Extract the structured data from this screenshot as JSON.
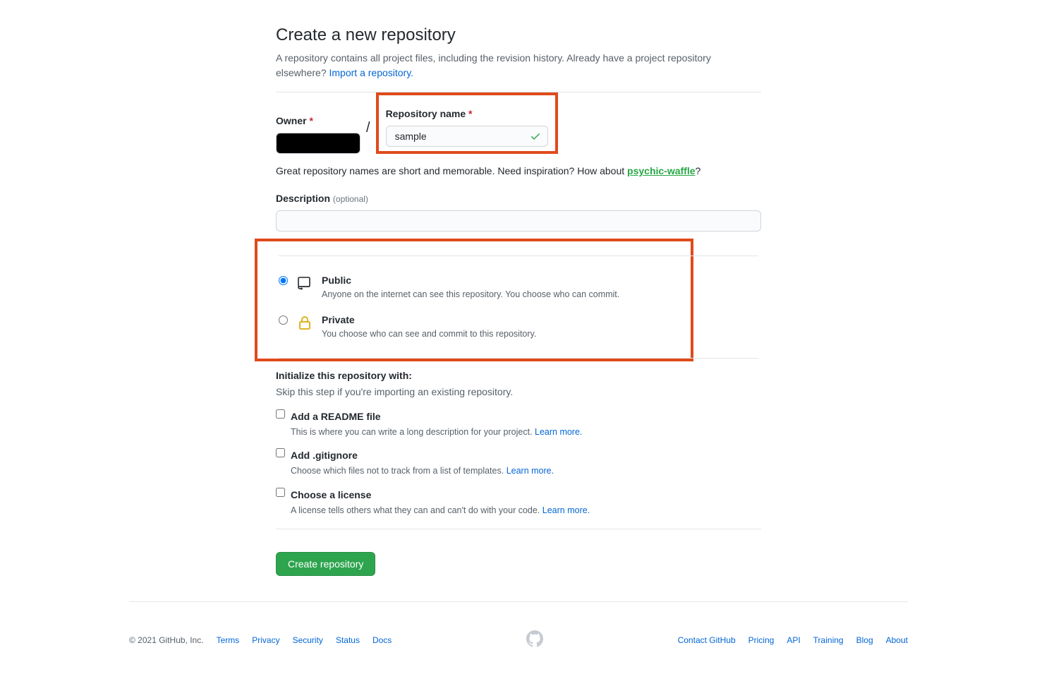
{
  "header": {
    "title": "Create a new repository",
    "subtitle_pre": "A repository contains all project files, including the revision history. Already have a project repository elsewhere? ",
    "import_link": "Import a repository."
  },
  "form": {
    "owner_label": "Owner",
    "repo_label": "Repository name",
    "repo_value": "sample",
    "hint_pre": "Great repository names are short and memorable. Need inspiration? How about ",
    "suggestion": "psychic-waffle",
    "hint_post": "?",
    "description_label": "Description",
    "optional_label": "(optional)",
    "description_value": ""
  },
  "visibility": {
    "public": {
      "title": "Public",
      "desc": "Anyone on the internet can see this repository. You choose who can commit."
    },
    "private": {
      "title": "Private",
      "desc": "You choose who can see and commit to this repository."
    }
  },
  "init": {
    "heading": "Initialize this repository with:",
    "sub": "Skip this step if you're importing an existing repository.",
    "readme": {
      "title": "Add a README file",
      "desc": "This is where you can write a long description for your project. ",
      "learn": "Learn more."
    },
    "gitignore": {
      "title": "Add .gitignore",
      "desc": "Choose which files not to track from a list of templates. ",
      "learn": "Learn more."
    },
    "license": {
      "title": "Choose a license",
      "desc": "A license tells others what they can and can't do with your code. ",
      "learn": "Learn more."
    }
  },
  "submit_label": "Create repository",
  "footer": {
    "copyright": "© 2021 GitHub, Inc.",
    "left_links": [
      "Terms",
      "Privacy",
      "Security",
      "Status",
      "Docs"
    ],
    "right_links": [
      "Contact GitHub",
      "Pricing",
      "API",
      "Training",
      "Blog",
      "About"
    ]
  }
}
